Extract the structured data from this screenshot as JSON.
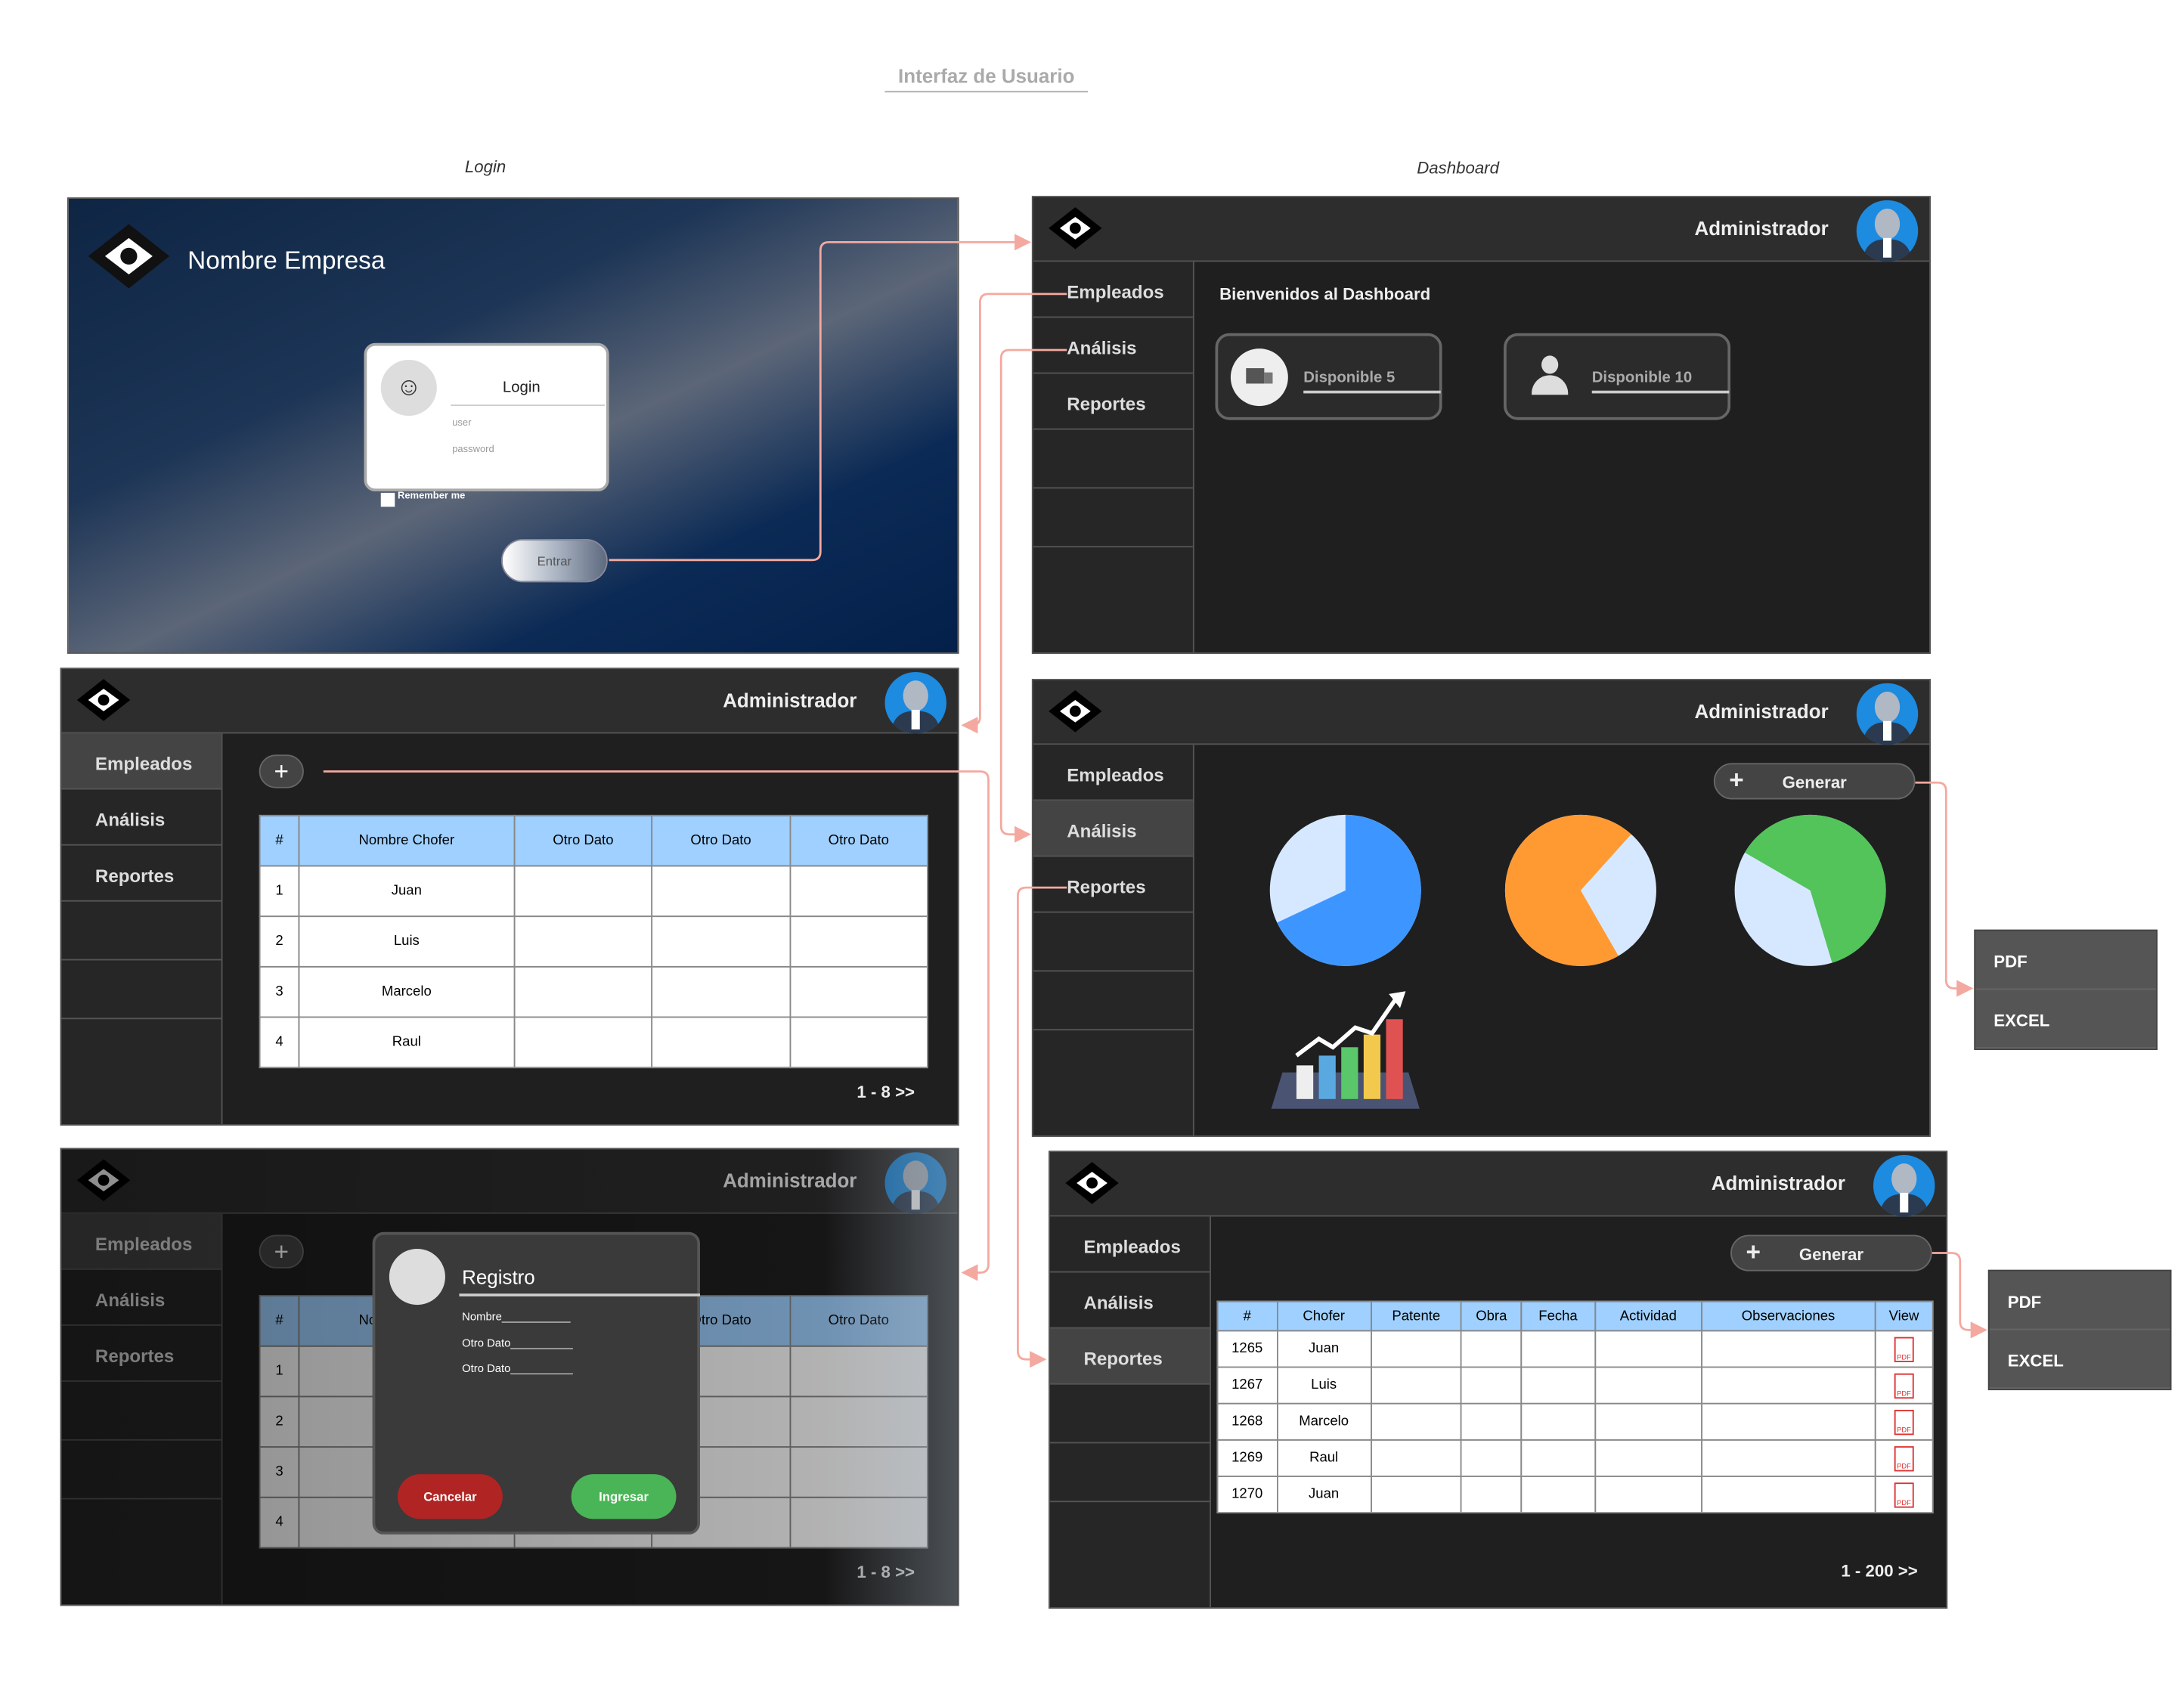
{
  "diagram_title": "Interfaz de Usuario",
  "captions": {
    "login": "Login",
    "dashboard": "Dashboard"
  },
  "login": {
    "company": "Nombre Empresa",
    "heading": "Login",
    "user_placeholder": "user",
    "password_placeholder": "password",
    "remember": "Remember me",
    "button": "Entrar"
  },
  "admin": "Administrador",
  "menu": {
    "empleados": "Empleados",
    "analisis": "Análisis",
    "reportes": "Reportes"
  },
  "dashboard": {
    "welcome": "Bienvenidos al Dashboard",
    "card1": "Disponible 5",
    "card2": "Disponible 10"
  },
  "employees": {
    "headers": [
      "#",
      "Nombre Chofer",
      "Otro Dato",
      "Otro Dato",
      "Otro Dato"
    ],
    "rows": [
      [
        "1",
        "Juan"
      ],
      [
        "2",
        "Luis"
      ],
      [
        "3",
        "Marcelo"
      ],
      [
        "4",
        "Raul"
      ]
    ],
    "pagination": "1 - 8  >>",
    "add": "+"
  },
  "registro": {
    "title": "Registro",
    "fields": [
      "Nombre___________",
      "Otro Dato__________",
      "Otro Dato__________"
    ],
    "cancel": "Cancelar",
    "submit": "Ingresar"
  },
  "analysis": {
    "generate": "Generar",
    "plus": "+",
    "pies": [
      {
        "fraction": 0.68,
        "color": "#3d96ff",
        "rest": "#d6e8ff"
      },
      {
        "fraction": 0.7,
        "color": "#ff9a33",
        "rest": "#d6e8ff"
      },
      {
        "fraction": 0.62,
        "color": "#52c45a",
        "rest": "#d6e8ff"
      }
    ]
  },
  "export": {
    "pdf": "PDF",
    "excel": "EXCEL"
  },
  "reports": {
    "headers": [
      "#",
      "Chofer",
      "Patente",
      "Obra",
      "Fecha",
      "Actividad",
      "Observaciones",
      "View"
    ],
    "rows": [
      [
        "1265",
        "Juan"
      ],
      [
        "1267",
        "Luis"
      ],
      [
        "1268",
        "Marcelo"
      ],
      [
        "1269",
        "Raul"
      ],
      [
        "1270",
        "Juan"
      ]
    ],
    "pagination": "1 - 200  >>",
    "pdf_label": "PDF"
  }
}
